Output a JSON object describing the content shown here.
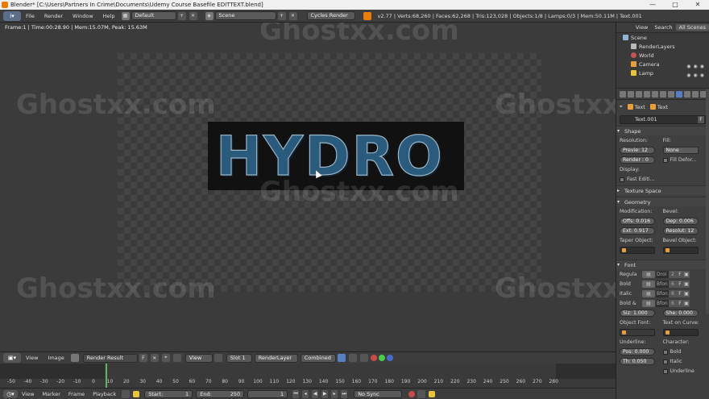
{
  "window": {
    "title": "Blender* [C:\\Users\\Partners In Crime\\Documents\\Udemy  Course  Basefile EDITTEXT.blend]",
    "minimize": "—",
    "maximize": "□",
    "close": "✕"
  },
  "header": {
    "menus": [
      "File",
      "Render",
      "Window",
      "Help"
    ],
    "layout": "Default",
    "scene": "Scene",
    "engine": "Cycles Render",
    "stats": "v2.77 | Verts:68,260 | Faces:62,268 | Tris:123,028 | Objects:1/8 | Lamps:0/3 | Mem:50.11M | Text.001"
  },
  "viewport": {
    "frame_info": "Frame:1 | Time:00:28.90 | Mem:15.07M, Peak: 15.63M",
    "render_text": "HYDRO",
    "watermark": "Ghostxx.com"
  },
  "image_header": {
    "view": "View",
    "image": "Image",
    "image_name": "Render Result",
    "view_mode": "View",
    "slot": "Slot 1",
    "layer": "RenderLayer",
    "pass": "Combined"
  },
  "timeline": {
    "ticks": [
      "-50",
      "-40",
      "-30",
      "-20",
      "-10",
      "0",
      "10",
      "20",
      "30",
      "40",
      "50",
      "60",
      "70",
      "80",
      "90",
      "100",
      "110",
      "120",
      "130",
      "140",
      "150",
      "160",
      "170",
      "180",
      "190",
      "200",
      "210",
      "220",
      "230",
      "240",
      "250",
      "260",
      "270",
      "280"
    ],
    "current_frame": 1,
    "menus": [
      "View",
      "Marker",
      "Frame",
      "Playback"
    ],
    "start_label": "Start:",
    "start_value": "1",
    "end_label": "End:",
    "end_value": "250",
    "frame_value": "1",
    "sync": "No Sync"
  },
  "outliner": {
    "tabs": [
      "View",
      "Search",
      "All Scenes"
    ],
    "items": [
      {
        "label": "Scene",
        "color": "#8fb5d9"
      },
      {
        "label": "RenderLayers",
        "color": "#b9b9b9"
      },
      {
        "label": "World",
        "color": "#c25454"
      },
      {
        "label": "Camera",
        "color": "#e89e3c"
      },
      {
        "label": "Lamp",
        "color": "#e8c43c"
      }
    ]
  },
  "properties": {
    "breadcrumb": [
      "Text",
      "Text"
    ],
    "datablock": "Text.001",
    "datablock_f": "F",
    "shape": {
      "title": "Shape",
      "resolution_label": "Resolution:",
      "fill_label": "Fill:",
      "preview": "Previe: 12",
      "render": "Render : 0",
      "fill": "None",
      "fill_deform": "Fill Defor...",
      "display_label": "Display:",
      "fast_edit": "Fast Editi..."
    },
    "texture_space": "Texture Space",
    "geometry": {
      "title": "Geometry",
      "modification_label": "Modification:",
      "bevel_label": "Bevel:",
      "offset": "Offs: 0.016",
      "depth": "Dep: 0.006",
      "extrude": "Ext: 0.917",
      "resolution": "Resolut: 12",
      "taper_label": "Taper Object:",
      "bevel_obj_label": "Bevel Object:"
    },
    "font": {
      "title": "Font",
      "rows": [
        {
          "label": "Regula",
          "name": "Droi",
          "num": "2"
        },
        {
          "label": "Bold",
          "name": "Bfon",
          "num": "6"
        },
        {
          "label": "Italic",
          "name": "Bfon",
          "num": "6"
        },
        {
          "label": "Bold &",
          "name": "Bfon",
          "num": "6"
        }
      ],
      "font_f": "F",
      "size": "Siz: 1.000",
      "shear": "She: 0.000",
      "object_font_label": "Object Font:",
      "text_on_curve_label": "Text on Curve:",
      "underline_label": "Underline:",
      "character_label": "Character:",
      "position": "Pos: 0.000",
      "thickness": "Th: 0.050",
      "bold": "Bold",
      "italic": "Italic",
      "underline": "Underline"
    }
  }
}
